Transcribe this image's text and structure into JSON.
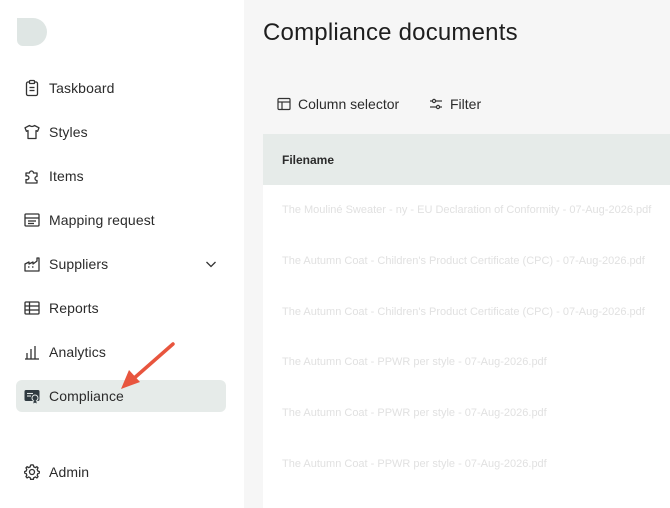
{
  "sidebar": {
    "items": [
      {
        "label": "Taskboard",
        "icon": "clipboard-icon"
      },
      {
        "label": "Styles",
        "icon": "tshirt-icon"
      },
      {
        "label": "Items",
        "icon": "puzzle-icon"
      },
      {
        "label": "Mapping request",
        "icon": "mapping-list-icon"
      },
      {
        "label": "Suppliers",
        "icon": "suppliers-icon"
      },
      {
        "label": "Reports",
        "icon": "report-table-icon"
      },
      {
        "label": "Analytics",
        "icon": "bar-chart-icon"
      },
      {
        "label": "Compliance",
        "icon": "compliance-badge-icon"
      }
    ],
    "active_item": "Compliance",
    "admin_label": "Admin"
  },
  "main": {
    "title": "Compliance documents",
    "toolbar": {
      "column_selector_label": "Column selector",
      "filter_label": "Filter"
    },
    "table": {
      "columns": [
        "Filename"
      ],
      "rows": [
        "The Mouliné Sweater - ny - EU Declaration of Conformity - 07-Aug-2026.pdf",
        "The Autumn Coat - Children's Product Certificate (CPC) - 07-Aug-2026.pdf",
        "The Autumn Coat - Children's Product Certificate (CPC) - 07-Aug-2026.pdf",
        "The Autumn Coat - PPWR per style - 07-Aug-2026.pdf",
        "The Autumn Coat - PPWR per style - 07-Aug-2026.pdf",
        "The Autumn Coat - PPWR per style - 07-Aug-2026.pdf"
      ]
    }
  },
  "colors": {
    "sidebar_bg": "#ffffff",
    "main_bg": "#f6f6f6",
    "active_bg": "#e6ebe9",
    "logo": "#dfe6e4",
    "arrow": "#e8553e"
  }
}
